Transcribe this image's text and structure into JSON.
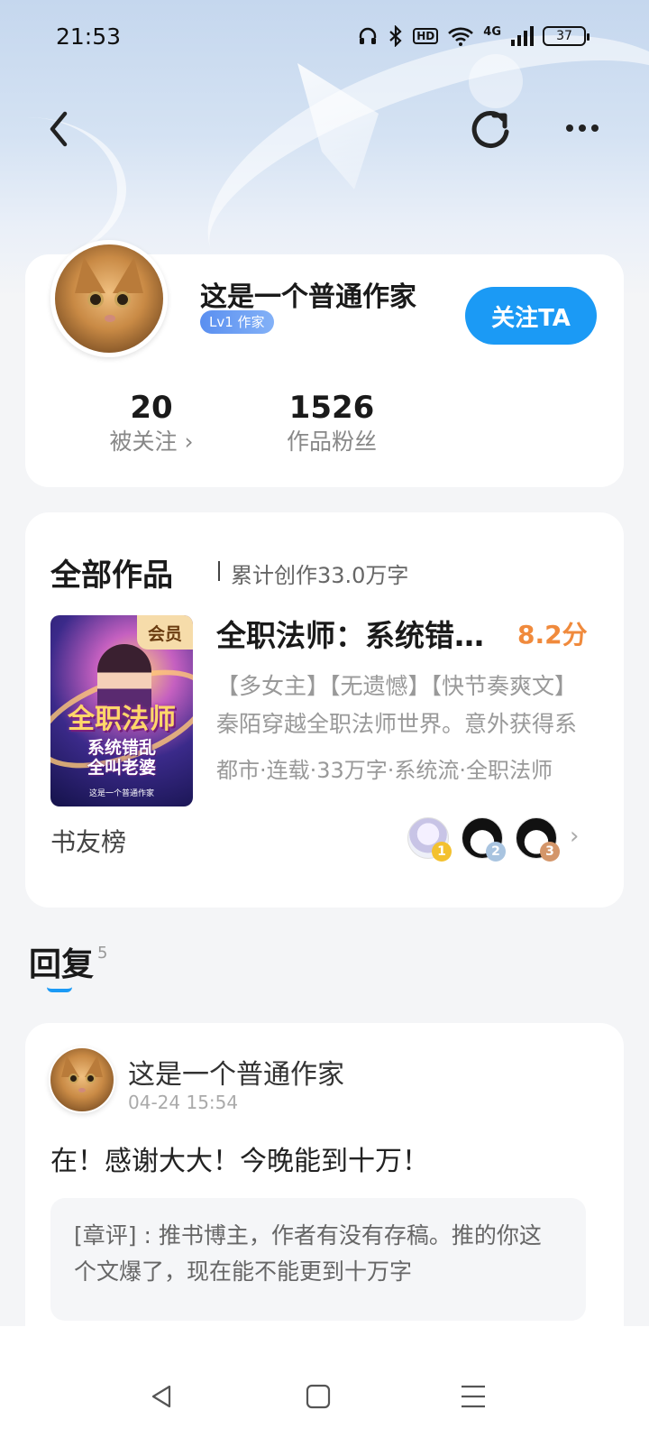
{
  "status_bar": {
    "time": "21:53",
    "hd": "HD",
    "network": "4G",
    "battery": "37"
  },
  "icons": {
    "back": "back-icon",
    "refresh": "refresh-icon",
    "more": "more-icon"
  },
  "profile": {
    "name": "这是一个普通作家",
    "level": "Lv1 作家",
    "follow_label": "关注TA",
    "followers_count": "20",
    "followers_label": "被关注 ›",
    "fans_count": "1526",
    "fans_label": "作品粉丝"
  },
  "works": {
    "title": "全部作品",
    "total": "累计创作33.0万字",
    "book": {
      "cover_title": "全职法师",
      "cover_subtitle_1": "系统错乱",
      "cover_subtitle_2": "全叫老婆",
      "cover_author": "这是一个普通作家",
      "vip": "会员",
      "title": "全职法师：系统错乱全叫老婆",
      "score": "8.2分",
      "description": "【多女主】【无遗憾】【快节奏爽文】秦陌穿越全职法师世界。意外获得系统",
      "tags": "都市·连载·33万字·系统流·全职法师"
    },
    "fans_rank_label": "书友榜",
    "rank": [
      {
        "num": "1",
        "color": "#f3c130"
      },
      {
        "num": "2",
        "color": "#a9c4e0"
      },
      {
        "num": "3",
        "color": "#d4966a"
      }
    ]
  },
  "reply_tab": {
    "label": "回复",
    "count": "5"
  },
  "reply": {
    "author": "这是一个普通作家",
    "time": "04-24 15:54",
    "text": "在！感谢大大！今晚能到十万！",
    "quote": "[章评] : 推书博主，作者有没有存稿。推的你这个文爆了，现在能不能更到十万字"
  },
  "colors": {
    "accent": "#1b9af5",
    "score": "#f08a3c"
  }
}
